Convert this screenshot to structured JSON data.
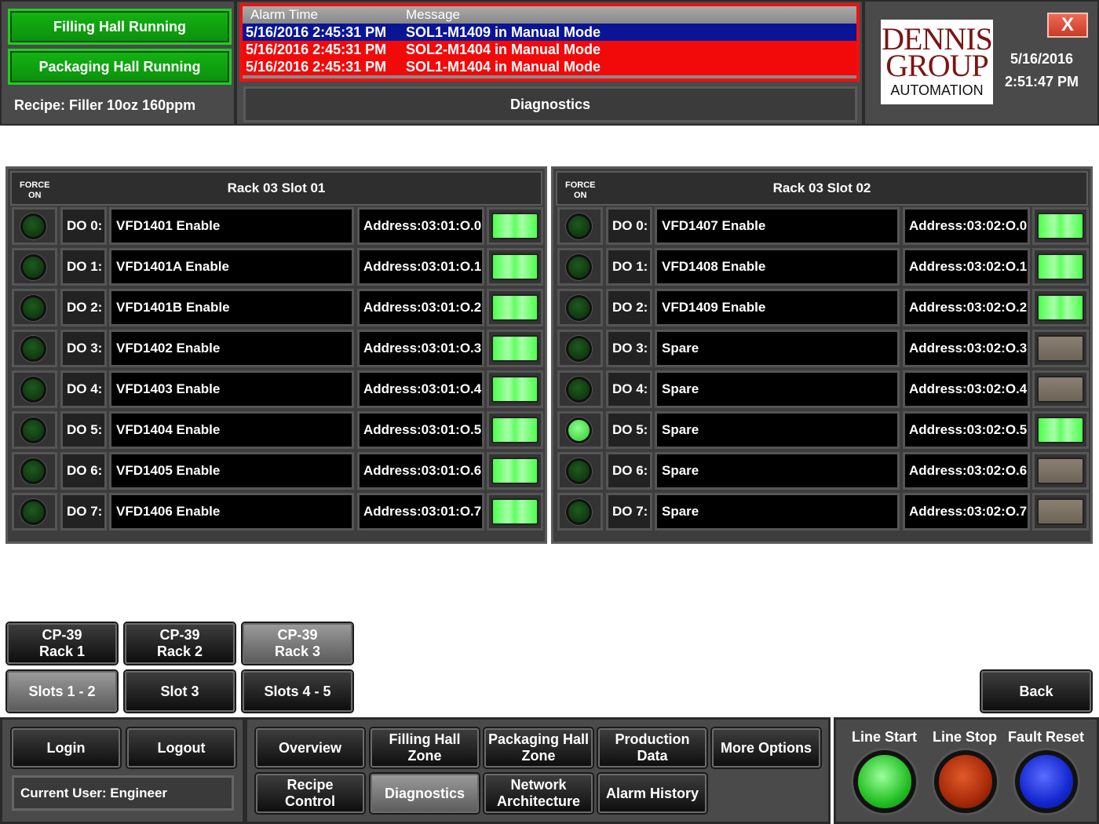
{
  "header": {
    "status_1": "Filling Hall Running",
    "status_2": "Packaging Hall Running",
    "recipe": "Recipe: Filler 10oz 160ppm",
    "screen_title": "Diagnostics",
    "logo": {
      "line1": "DENNIS",
      "line2": "GROUP",
      "line3": "AUTOMATION"
    },
    "date": "5/16/2016",
    "time": "2:51:47 PM",
    "close_symbol": "X"
  },
  "alarms": {
    "col_time": "Alarm Time",
    "col_message": "Message",
    "rows": [
      {
        "time": "5/16/2016 2:45:31 PM",
        "message": "SOL1-M1409 in Manual Mode"
      },
      {
        "time": "5/16/2016 2:45:31 PM",
        "message": "SOL2-M1404 in Manual Mode"
      },
      {
        "time": "5/16/2016 2:45:31 PM",
        "message": "SOL1-M1404 in Manual Mode"
      }
    ]
  },
  "racks": [
    {
      "force_label_1": "FORCE",
      "force_label_2": "ON",
      "title": "Rack 03 Slot 01",
      "rows": [
        {
          "do": "DO 0:",
          "name": "VFD1401 Enable",
          "address": "Address:03:01:O.0",
          "forced": false,
          "on": true
        },
        {
          "do": "DO 1:",
          "name": "VFD1401A Enable",
          "address": "Address:03:01:O.1",
          "forced": false,
          "on": true
        },
        {
          "do": "DO 2:",
          "name": "VFD1401B Enable",
          "address": "Address:03:01:O.2",
          "forced": false,
          "on": true
        },
        {
          "do": "DO 3:",
          "name": "VFD1402 Enable",
          "address": "Address:03:01:O.3",
          "forced": false,
          "on": true
        },
        {
          "do": "DO 4:",
          "name": "VFD1403 Enable",
          "address": "Address:03:01:O.4",
          "forced": false,
          "on": true
        },
        {
          "do": "DO 5:",
          "name": "VFD1404 Enable",
          "address": "Address:03:01:O.5",
          "forced": false,
          "on": true
        },
        {
          "do": "DO 6:",
          "name": "VFD1405 Enable",
          "address": "Address:03:01:O.6",
          "forced": false,
          "on": true
        },
        {
          "do": "DO 7:",
          "name": "VFD1406 Enable",
          "address": "Address:03:01:O.7",
          "forced": false,
          "on": true
        }
      ]
    },
    {
      "force_label_1": "FORCE",
      "force_label_2": "ON",
      "title": "Rack 03 Slot 02",
      "rows": [
        {
          "do": "DO 0:",
          "name": "VFD1407 Enable",
          "address": "Address:03:02:O.0",
          "forced": false,
          "on": true
        },
        {
          "do": "DO 1:",
          "name": "VFD1408 Enable",
          "address": "Address:03:02:O.1",
          "forced": false,
          "on": true
        },
        {
          "do": "DO 2:",
          "name": "VFD1409 Enable",
          "address": "Address:03:02:O.2",
          "forced": false,
          "on": true
        },
        {
          "do": "DO 3:",
          "name": "Spare",
          "address": "Address:03:02:O.3",
          "forced": false,
          "on": false
        },
        {
          "do": "DO 4:",
          "name": "Spare",
          "address": "Address:03:02:O.4",
          "forced": false,
          "on": false
        },
        {
          "do": "DO 5:",
          "name": "Spare",
          "address": "Address:03:02:O.5",
          "forced": true,
          "on": true
        },
        {
          "do": "DO 6:",
          "name": "Spare",
          "address": "Address:03:02:O.6",
          "forced": false,
          "on": false
        },
        {
          "do": "DO 7:",
          "name": "Spare",
          "address": "Address:03:02:O.7",
          "forced": false,
          "on": false
        }
      ]
    }
  ],
  "rack_select": {
    "rack1": "CP-39\nRack 1",
    "rack2": "CP-39\nRack 2",
    "rack3": "CP-39\nRack 3",
    "slots12": "Slots 1 - 2",
    "slot3": "Slot 3",
    "slots45": "Slots 4 - 5",
    "back": "Back"
  },
  "footer": {
    "login": "Login",
    "logout": "Logout",
    "current_user": "Current User: Engineer",
    "nav": {
      "overview": "Overview",
      "filling_hall": "Filling Hall\nZone",
      "packaging_hall": "Packaging Hall\nZone",
      "production": "Production\nData",
      "more": "More Options",
      "recipe": "Recipe\nControl",
      "diagnostics": "Diagnostics",
      "network": "Network\nArchitecture",
      "alarm_history": "Alarm History"
    },
    "line_start": "Line Start",
    "line_stop": "Line Stop",
    "fault_reset": "Fault Reset"
  }
}
